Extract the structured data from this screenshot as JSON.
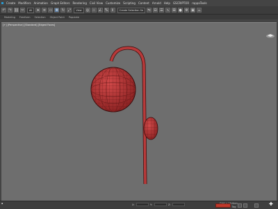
{
  "menu": [
    "Create",
    "Modifiers",
    "Animation",
    "Graph Editors",
    "Rendering",
    "Civil View",
    "Customize",
    "Scripting",
    "Content",
    "Arnold",
    "Help",
    "GSCRIPTOR",
    "rappaTools"
  ],
  "toolbar": {
    "selection_filter": "All",
    "view_dropdown": "View",
    "named_selection": "Create Selection Se"
  },
  "ribbon": [
    "Modeling",
    "Freeform",
    "Selection",
    "Object Paint",
    "Populate"
  ],
  "viewport": {
    "label": "[+] [Perspective] [Standard] [Edged Faces]",
    "object_color": "#b73a3a",
    "background_color": "#6e6e6e"
  },
  "status": {
    "x_label": "X:",
    "y_label": "Y:",
    "z_label": "Z:",
    "grid": "Grid = 10.0cm",
    "tag": "Add Time Tag",
    "auto_key": "Auto Key",
    "set_key": "Set K."
  }
}
